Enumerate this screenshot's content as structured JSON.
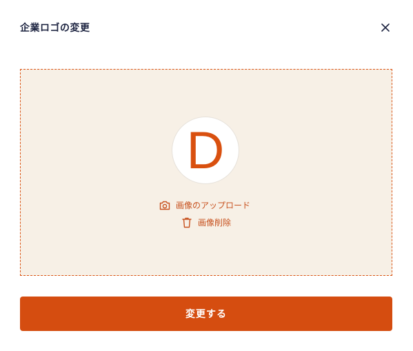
{
  "modal": {
    "title": "企業ロゴの変更",
    "close_icon": "close-icon"
  },
  "logo": {
    "letter": "D",
    "color": "#d9500f"
  },
  "actions": {
    "upload_label": "画像のアップロード",
    "upload_icon": "camera-icon",
    "delete_label": "画像削除",
    "delete_icon": "trash-icon"
  },
  "submit": {
    "label": "変更する",
    "color": "#d54d10"
  },
  "colors": {
    "accent": "#d54d10",
    "drop_zone_bg": "#f7f0e6",
    "title_text": "#1c2340"
  }
}
